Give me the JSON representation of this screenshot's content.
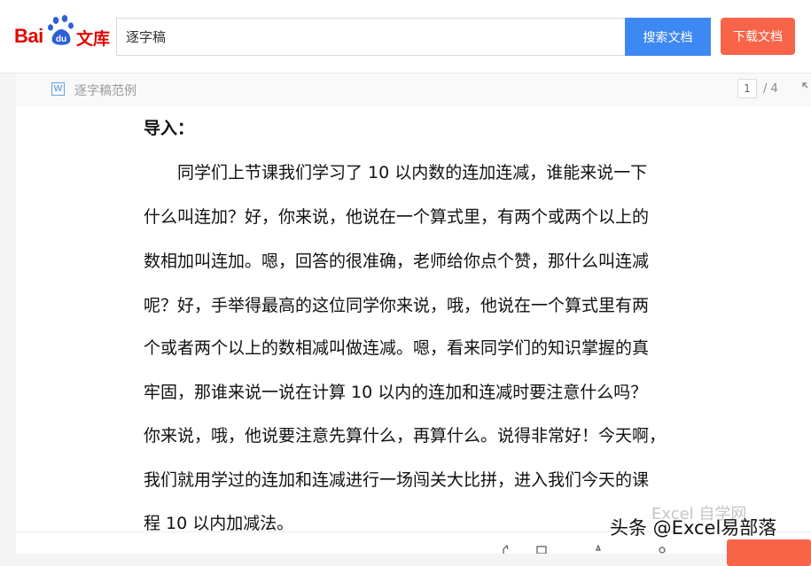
{
  "header": {
    "logo_text_latin": "Bai",
    "logo_text_paw": "du",
    "logo_text_cn": "文库",
    "search_value": "逐字稿",
    "search_button": "搜索文档",
    "download_button": "下载文档"
  },
  "doc_bar": {
    "file_icon_letter": "W",
    "title": "逐字稿范例",
    "current_page": "1",
    "total_pages": "/ 4"
  },
  "document": {
    "intro_label": "导入：",
    "lines": [
      "　　同学们上节课我们学习了 10 以内数的连加连减，谁能来说一下",
      "什么叫连加？好，你来说，他说在一个算式里，有两个或两个以上的",
      "数相加叫连加。嗯，回答的很准确，老师给你点个赞，那什么叫连减",
      "呢？好，手举得最高的这位同学你来说，哦，他说在一个算式里有两",
      "个或者两个以上的数相减叫做连减。嗯，看来同学们的知识掌握的真",
      "牢固，那谁来说一说在计算 10 以内的连加和连减时要注意什么吗？",
      "你来说，哦，他说要注意先算什么，再算什么。说得非常好！今天啊，",
      "我们就用学过的连加和连减进行一场闯关大比拼，进入我们今天的课",
      "程 10 以内加减法。"
    ]
  },
  "watermark": {
    "main": "头条 @Excel易部落",
    "faint": "Excel 自学网"
  },
  "colors": {
    "brand_red": "#e10601",
    "search_blue": "#3e88f3",
    "download_orange": "#f76448"
  }
}
